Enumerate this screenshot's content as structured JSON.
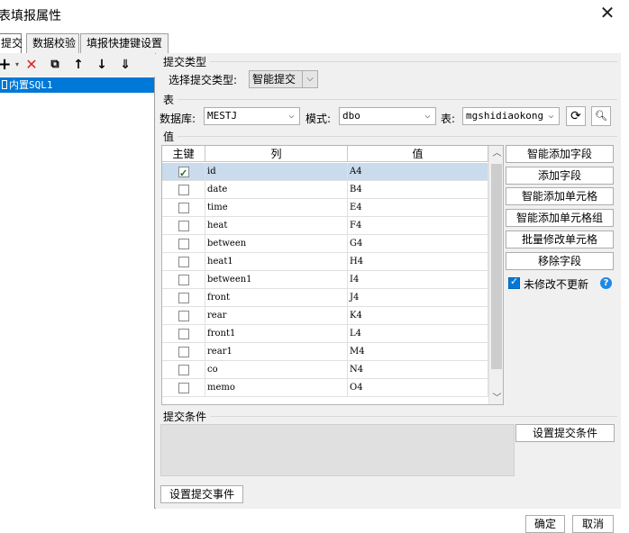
{
  "window": {
    "title": "表填报属性",
    "close_icon": "close-icon"
  },
  "tabs": [
    {
      "label": "提交"
    },
    {
      "label": "数据校验"
    },
    {
      "label": "填报快捷键设置"
    }
  ],
  "left": {
    "toolbar": [
      {
        "name": "add-icon",
        "glyph": "+"
      },
      {
        "name": "delete-icon",
        "glyph": "✕"
      },
      {
        "name": "copy-icon",
        "glyph": "⧉"
      },
      {
        "name": "move-up-icon",
        "glyph": "↑"
      },
      {
        "name": "move-down-icon",
        "glyph": "↓"
      },
      {
        "name": "move-bottom-icon",
        "glyph": "⇓"
      }
    ],
    "items": [
      {
        "label": "内置SQL1"
      }
    ]
  },
  "submit_type": {
    "section": "提交类型",
    "label": "选择提交类型:",
    "value": "智能提交"
  },
  "table_section": {
    "section": "表",
    "db_label": "数据库:",
    "db_value": "MESTJ",
    "schema_label": "模式:",
    "schema_value": "dbo",
    "table_label": "表:",
    "table_value": "mgshidiaokong"
  },
  "values": {
    "section": "值",
    "headers": {
      "key": "主键",
      "column": "列",
      "value": "值"
    },
    "rows": [
      {
        "key": true,
        "column": "id",
        "value": "A4"
      },
      {
        "key": false,
        "column": "date",
        "value": "B4"
      },
      {
        "key": false,
        "column": "time",
        "value": "E4"
      },
      {
        "key": false,
        "column": "heat",
        "value": "F4"
      },
      {
        "key": false,
        "column": "between",
        "value": "G4"
      },
      {
        "key": false,
        "column": "heat1",
        "value": "H4"
      },
      {
        "key": false,
        "column": "between1",
        "value": "I4"
      },
      {
        "key": false,
        "column": "front",
        "value": "J4"
      },
      {
        "key": false,
        "column": "rear",
        "value": "K4"
      },
      {
        "key": false,
        "column": "front1",
        "value": "L4"
      },
      {
        "key": false,
        "column": "rear1",
        "value": "M4"
      },
      {
        "key": false,
        "column": "co",
        "value": "N4"
      },
      {
        "key": false,
        "column": "memo",
        "value": "O4"
      }
    ],
    "buttons": {
      "smart_add_field": "智能添加字段",
      "add_field": "添加字段",
      "smart_add_cell": "智能添加单元格",
      "smart_add_cell_group": "智能添加单元格组",
      "batch_modify_cell": "批量修改单元格",
      "remove_field": "移除字段"
    },
    "no_update_label": "未修改不更新",
    "no_update_checked": true,
    "help_glyph": "?"
  },
  "condition": {
    "section": "提交条件",
    "set_button": "设置提交条件"
  },
  "event_button": "设置提交事件",
  "footer": {
    "ok": "确定",
    "cancel": "取消"
  }
}
